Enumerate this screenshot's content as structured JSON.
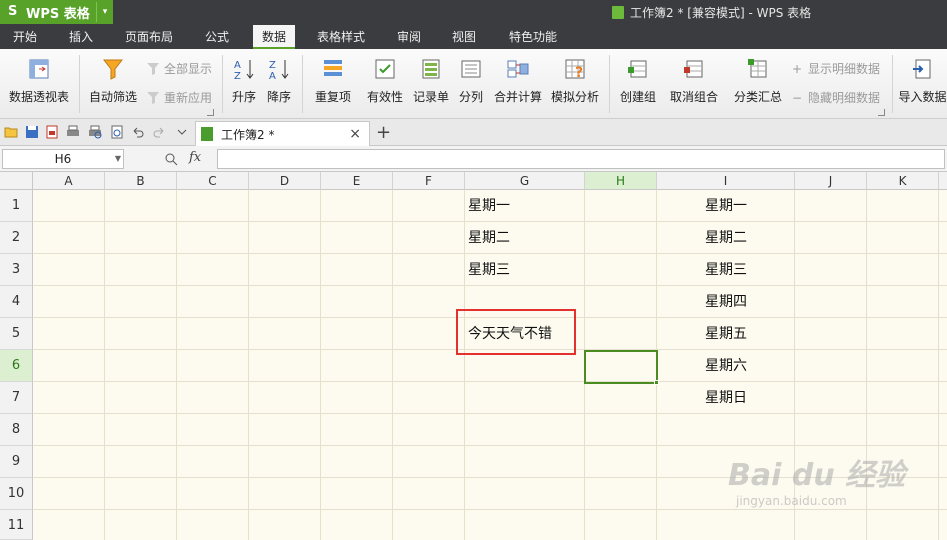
{
  "app": {
    "logo_text": "S",
    "name": "WPS 表格",
    "dropdown_arrow": "▾",
    "window_title": "工作簿2 * [兼容模式] - WPS 表格"
  },
  "menu": {
    "tabs": [
      {
        "label": "开始"
      },
      {
        "label": "插入"
      },
      {
        "label": "页面布局"
      },
      {
        "label": "公式"
      },
      {
        "label": "数据",
        "active": true
      },
      {
        "label": "表格样式"
      },
      {
        "label": "审阅"
      },
      {
        "label": "视图"
      },
      {
        "label": "特色功能"
      }
    ]
  },
  "ribbon": {
    "pivot": "数据透视表",
    "autofilter": "自动筛选",
    "show_all": "全部显示",
    "reapply": "重新应用",
    "sort_asc": "升序",
    "sort_desc": "降序",
    "duplicates": "重复项",
    "validation": "有效性",
    "record": "记录单",
    "split": "分列",
    "consolidate": "合并计算",
    "whatif": "模拟分析",
    "group": "创建组",
    "ungroup": "取消组合",
    "subtotal": "分类汇总",
    "show_detail": "显示明细数据",
    "hide_detail": "隐藏明细数据",
    "import": "导入数据"
  },
  "doc_tab": {
    "label": "工作簿2 *",
    "close": "×",
    "new_tab": "+"
  },
  "formula_bar": {
    "name_box": "H6",
    "fx": "fx",
    "value": ""
  },
  "sheet": {
    "columns": [
      "A",
      "B",
      "C",
      "D",
      "E",
      "F",
      "G",
      "H",
      "I",
      "J",
      "K"
    ],
    "rows": [
      "1",
      "2",
      "3",
      "4",
      "5",
      "6",
      "7",
      "8",
      "9",
      "10",
      "11"
    ],
    "selected_column": "H",
    "selected_row": "6",
    "cells": {
      "G1": "星期一",
      "G2": "星期二",
      "G3": "星期三",
      "G5": "今天天气不错",
      "I1": "星期一",
      "I2": "星期二",
      "I3": "星期三",
      "I4": "星期四",
      "I5": "星期五",
      "I6": "星期六",
      "I7": "星期日"
    }
  },
  "watermark": {
    "main": "Bai du 经验",
    "sub": "jingyan.baidu.com"
  },
  "colors": {
    "accent_green": "#58a22a",
    "title_bar": "#3a3c40",
    "highlight_red": "#e53030",
    "sheet_bg": "#fdfbf0"
  }
}
